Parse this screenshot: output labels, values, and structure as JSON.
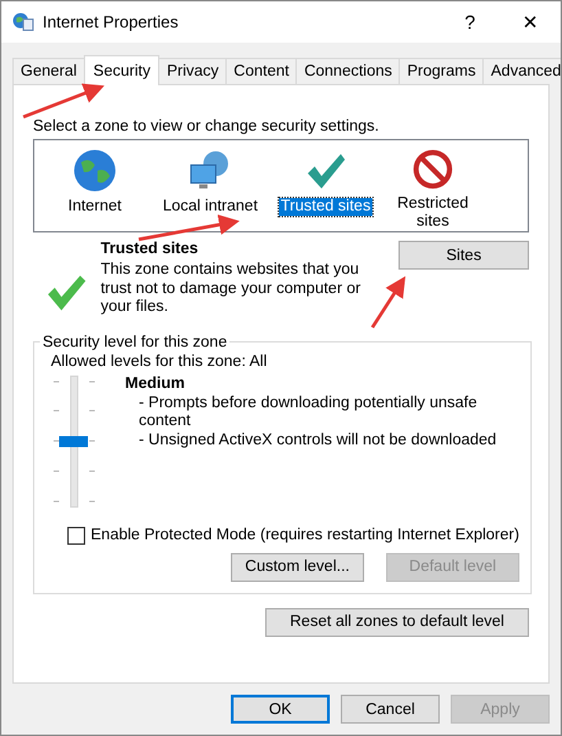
{
  "window": {
    "title": "Internet Properties",
    "help": "?",
    "close": "✕"
  },
  "tabs": [
    {
      "label": "General",
      "selected": false
    },
    {
      "label": "Security",
      "selected": true
    },
    {
      "label": "Privacy",
      "selected": false
    },
    {
      "label": "Content",
      "selected": false
    },
    {
      "label": "Connections",
      "selected": false
    },
    {
      "label": "Programs",
      "selected": false
    },
    {
      "label": "Advanced",
      "selected": false
    }
  ],
  "zone_prompt": "Select a zone to view or change security settings.",
  "zones": [
    {
      "label": "Internet",
      "kind": "globe",
      "selected": false
    },
    {
      "label": "Local intranet",
      "kind": "intranet",
      "selected": false
    },
    {
      "label": "Trusted sites",
      "kind": "check",
      "selected": true
    },
    {
      "label": "Restricted sites",
      "kind": "blocked",
      "selected": false
    }
  ],
  "zone_info": {
    "title": "Trusted sites",
    "description": "This zone contains websites that you trust not to damage your computer or your files.",
    "button": "Sites"
  },
  "security_level": {
    "legend": "Security level for this zone",
    "allowed": "Allowed levels for this zone: All",
    "level": 0.5,
    "name": "Medium",
    "details": [
      "- Prompts before downloading potentially unsafe content",
      "- Unsigned ActiveX controls will not be downloaded"
    ],
    "protected_mode": {
      "label": "Enable Protected Mode (requires restarting Internet Explorer)",
      "checked": false
    },
    "buttons": [
      {
        "label": "Custom level...",
        "disabled": false
      },
      {
        "label": "Default level",
        "disabled": true
      }
    ]
  },
  "reset_button": "Reset all zones to default level",
  "dialog_buttons": [
    {
      "label": "OK",
      "disabled": false,
      "default": true
    },
    {
      "label": "Cancel",
      "disabled": false,
      "default": false
    },
    {
      "label": "Apply",
      "disabled": true,
      "default": false
    }
  ]
}
